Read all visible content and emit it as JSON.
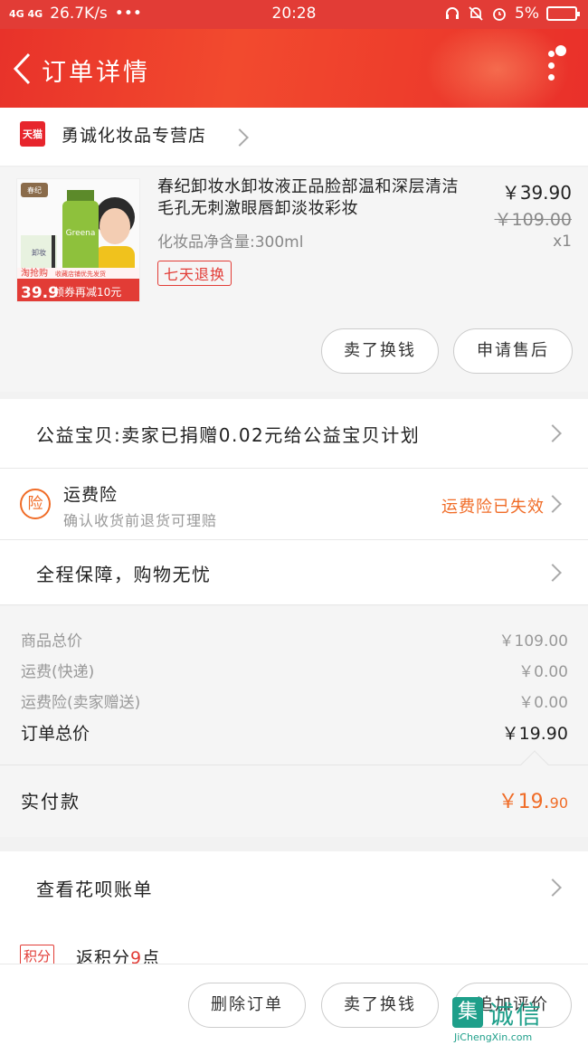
{
  "status_bar": {
    "network": "4G 4G",
    "speed": "26.7K/s",
    "dots": "•••",
    "time": "20:28",
    "battery": "5%"
  },
  "header": {
    "title": "订单详情",
    "back_icon": "chevron-left-icon",
    "more_icon": "more-vertical-icon"
  },
  "store": {
    "badge": "天猫",
    "name": "勇诚化妆品专营店"
  },
  "product": {
    "name": "春纪卸妆水卸妆液正品脸部温和深层清洁毛孔无刺激眼唇卸淡妆彩妆",
    "spec": "化妆品净含量:300ml",
    "return_tag": "七天退换",
    "price": "￥39.90",
    "original_price": "￥109.00",
    "quantity": "x1",
    "thumb": {
      "brand": "春纪",
      "banner_left": "淘抢购",
      "banner_price": "39.9",
      "banner_right": "领券再减10元",
      "banner_top": "收藏店铺优先发货",
      "small_text": "卸妆"
    },
    "buttons": {
      "sell": "卖了换钱",
      "after_sale": "申请售后"
    }
  },
  "charity": {
    "text": "公益宝贝:卖家已捐赠0.02元给公益宝贝计划"
  },
  "insurance": {
    "icon_text": "险",
    "title": "运费险",
    "subtitle": "确认收货前退货可理赔",
    "status": "运费险已失效"
  },
  "guarantee": {
    "text": "全程保障，购物无忧"
  },
  "summary": {
    "rows": [
      {
        "label": "商品总价",
        "value": "￥109.00"
      },
      {
        "label": "运费(快递)",
        "value": "￥0.00"
      },
      {
        "label": "运费险(卖家赠送)",
        "value": "￥0.00"
      }
    ],
    "total_label": "订单总价",
    "total_value": "￥19.90",
    "paid_label": "实付款",
    "paid_main": "￥19.",
    "paid_cents": "90"
  },
  "huabei": {
    "text": "查看花呗账单"
  },
  "points": {
    "badge": "积分",
    "text_prefix": "返积分",
    "count": "9",
    "text_suffix": "点"
  },
  "bottom": {
    "delete": "删除订单",
    "sell": "卖了换钱",
    "review": "追加评价"
  },
  "watermark": {
    "box": "集",
    "big": "诚信",
    "small": "JiChengXin.com"
  },
  "colors": {
    "brand_red": "#e23c36",
    "orange": "#f06c27",
    "watermark": "#1e9f8a"
  }
}
